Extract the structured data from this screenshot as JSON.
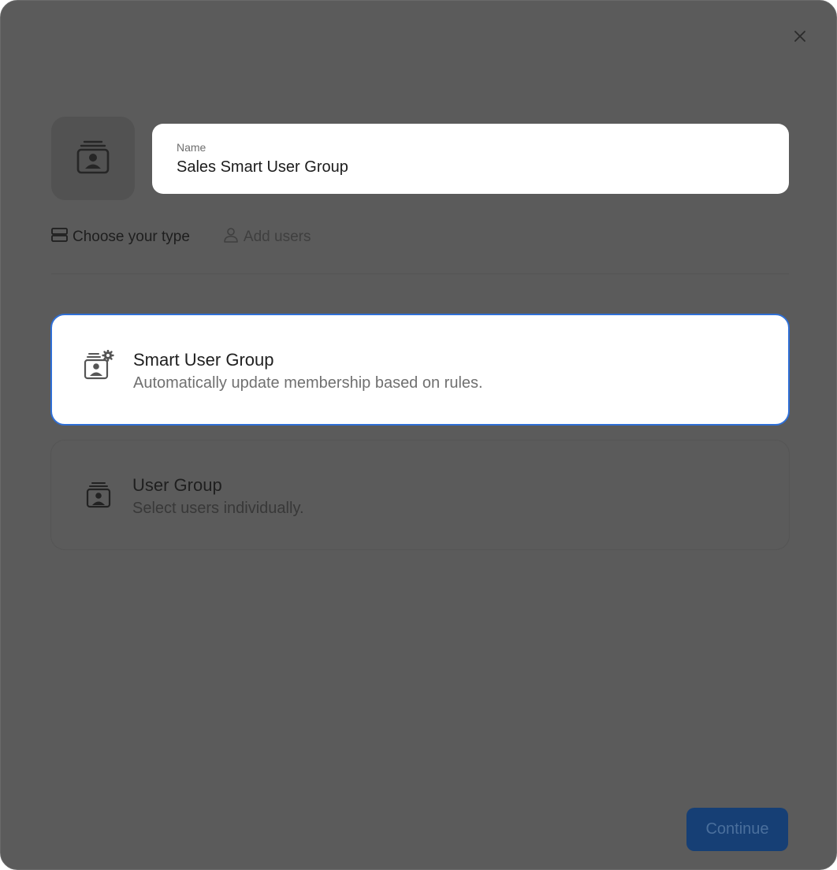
{
  "dialog": {
    "close_icon": "close-icon"
  },
  "group": {
    "avatar_icon": "user-group-icon",
    "name_label": "Name",
    "name_value": "Sales Smart User Group"
  },
  "steps": [
    {
      "label": "Choose your type",
      "icon": "stacked-rows-icon",
      "active": true
    },
    {
      "label": "Add users",
      "icon": "person-icon",
      "active": false
    }
  ],
  "types": [
    {
      "title": "Smart User Group",
      "description": "Automatically update membership based on rules.",
      "icon": "smart-user-group-icon",
      "selected": true
    },
    {
      "title": "User Group",
      "description": "Select users individually.",
      "icon": "user-group-icon",
      "selected": false
    }
  ],
  "actions": {
    "continue_label": "Continue",
    "continue_enabled": false
  },
  "colors": {
    "overlay_modal": "#5b5b5b",
    "selected_border": "#2f6fd6",
    "continue_button": "#163f75"
  }
}
